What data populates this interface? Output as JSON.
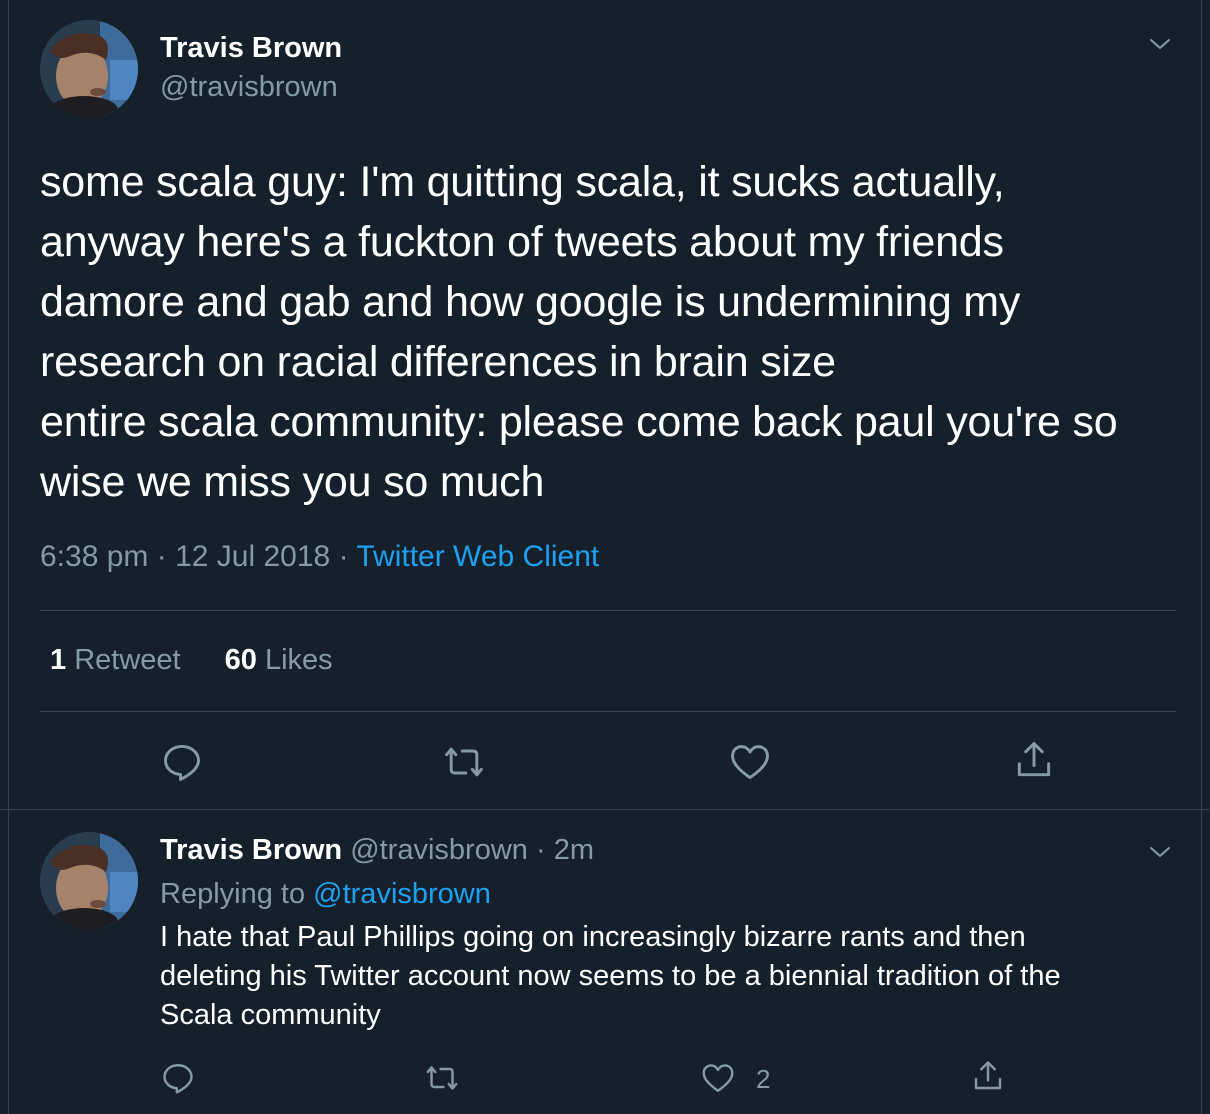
{
  "colors": {
    "background": "#15202b",
    "border": "#38444d",
    "muted": "#8899a6",
    "link": "#1da1f2",
    "text": "#ffffff"
  },
  "main_tweet": {
    "display_name": "Travis Brown",
    "handle": "@travisbrown",
    "text_lines": [
      "some scala guy: I'm quitting scala, it sucks actually,",
      "anyway here's a fuckton of tweets about my friends",
      "damore and gab and how google is undermining my",
      "research on racial differences in brain size",
      "entire scala community: please come back paul you're so",
      "wise we miss you so much"
    ],
    "time": "6:38 pm",
    "date": "12 Jul 2018",
    "separator": "·",
    "source": "Twitter Web Client",
    "retweet_count": "1",
    "retweet_label": "Retweet",
    "like_count": "60",
    "like_label": "Likes",
    "icons": [
      "reply-icon",
      "retweet-icon",
      "like-icon",
      "share-icon",
      "chevron-down-icon"
    ]
  },
  "reply_tweet": {
    "display_name": "Travis Brown",
    "handle": "@travisbrown",
    "separator": "·",
    "time_ago": "2m",
    "replying_prefix": "Replying to",
    "replying_to": "@travisbrown",
    "text_lines": [
      "I hate that Paul Phillips going on increasingly bizarre rants and then",
      "deleting his Twitter account now seems to be a biennial tradition of the",
      "Scala community"
    ],
    "like_count": "2",
    "icons": [
      "reply-icon",
      "retweet-icon",
      "like-icon",
      "share-icon",
      "chevron-down-icon"
    ]
  }
}
